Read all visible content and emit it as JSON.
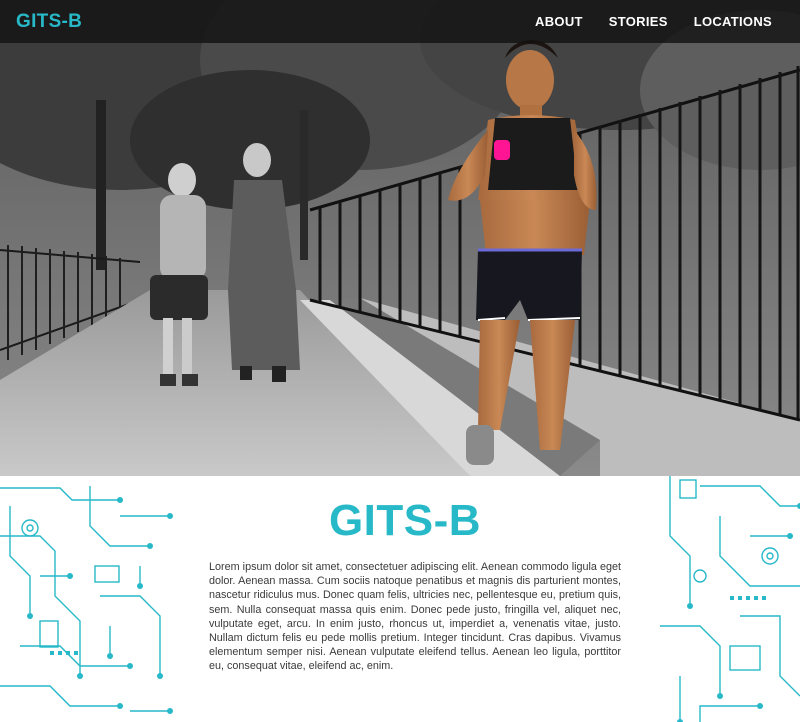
{
  "nav": {
    "brand": "GITS-B",
    "links": [
      "ABOUT",
      "STORIES",
      "LOCATIONS"
    ]
  },
  "hero": {
    "image": "black-and-white park walkway photo with a color-highlighted female runner in a black sports top and shorts holding a pink music player"
  },
  "main": {
    "heading": "GITS-B",
    "paragraph": "Lorem ipsum dolor sit amet, consectetuer adipiscing elit. Aenean commodo ligula eget dolor. Aenean massa. Cum sociis natoque penatibus et magnis dis parturient montes, nascetur ridiculus mus. Donec quam felis, ultricies nec, pellentesque eu, pretium quis, sem. Nulla consequat massa quis enim. Donec pede justo, fringilla vel, aliquet nec, vulputate eget, arcu. In enim justo, rhoncus ut, imperdiet a, venenatis vitae, justo. Nullam dictum felis eu pede mollis pretium. Integer tincidunt. Cras dapibus. Vivamus elementum semper nisi. Aenean vulputate eleifend tellus. Aenean leo ligula, porttitor eu, consequat vitae, eleifend ac, enim."
  },
  "decor": {
    "left": "circuit-board-pattern",
    "right": "circuit-board-pattern"
  },
  "colors": {
    "accent": "#27b9c8",
    "nav_bg": "#121212",
    "text": "#3a3a3a"
  }
}
